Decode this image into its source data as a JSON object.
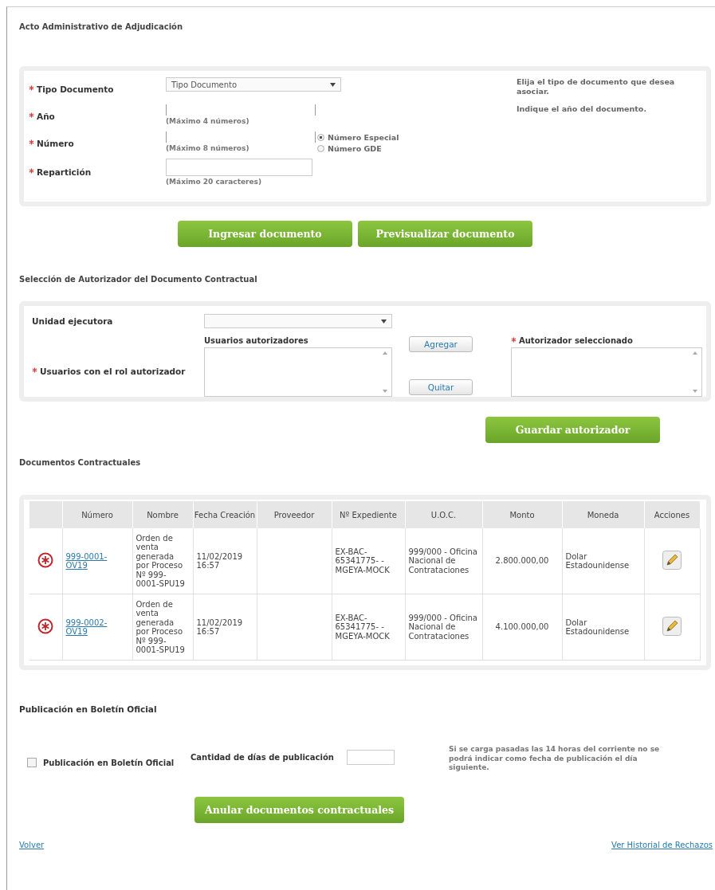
{
  "adjudicacion": {
    "title": "Acto Administrativo de Adjudicación",
    "fields": [
      {
        "label": "Tipo Documento",
        "required": true,
        "kind": "select",
        "value": "Tipo Documento",
        "hint": "Elija el tipo de documento que desea asociar."
      },
      {
        "label": "Año",
        "required": true,
        "kind": "open",
        "note": "(Máximo 4 números)",
        "hint": "Indique el año del documento."
      },
      {
        "label": "Número",
        "required": true,
        "kind": "open",
        "note": "(Máximo 8 números)",
        "options": [
          {
            "label": "Número Especial",
            "selected": true
          },
          {
            "label": "Número GDE",
            "selected": false
          }
        ]
      },
      {
        "label": "Repartición",
        "required": true,
        "kind": "box",
        "note": "(Máximo 20 caracteres)"
      }
    ],
    "buttons": [
      "Ingresar documento",
      "Previsualizar documento"
    ]
  },
  "autorizador": {
    "title": "Selección de Autorizador del Documento Contractual",
    "unidad_label": "Unidad ejecutora",
    "usuarios_label": "Usuarios con el rol autorizador",
    "usuarios_required": true,
    "list_title": "Usuarios autorizadores",
    "selected_title": "Autorizador seleccionado",
    "selected_required": true,
    "add": "Agregar",
    "remove": "Quitar",
    "save": "Guardar autorizador"
  },
  "documentos": {
    "title": "Documentos Contractuales",
    "columns": [
      "Número",
      "Nombre",
      "Fecha Creación",
      "Proveedor",
      "Nº Expediente",
      "U.O.C.",
      "Monto",
      "Moneda",
      "Acciones"
    ],
    "rows": [
      {
        "numero": "999-0001-OV19",
        "nombre": "Orden de venta generada por Proceso Nº 999-0001-SPU19",
        "fecha": "11/02/2019 16:57",
        "expediente": "EX-BAC-65341775- - MGEYA-MOCK",
        "uoc": "999/000 - Oficina Nacional de Contrataciones",
        "monto": "2.800.000,00",
        "moneda": "Dolar Estadounidense"
      },
      {
        "numero": "999-0002-OV19",
        "nombre": "Orden de venta generada por Proceso Nº 999-0001-SPU19",
        "fecha": "11/02/2019 16:57",
        "expediente": "EX-BAC-65341775- - MGEYA-MOCK",
        "uoc": "999/000 - Oficina Nacional de Contrataciones",
        "monto": "4.100.000,00",
        "moneda": "Dolar Estadounidense"
      }
    ]
  },
  "boletin": {
    "title": "Publicación en Boletín Oficial",
    "checkbox": {
      "label": "Publicación en Boletín Oficial",
      "checked": false
    },
    "dias_label": "Cantidad de días de publicación",
    "note": "Si se carga pasadas las 14 horas del corriente no se podrá indicar como fecha de publicación el día siguiente.",
    "button": "Anular documentos contractuales"
  },
  "footer": {
    "back": "Volver",
    "history": "Ver Historial de Rechazos"
  }
}
